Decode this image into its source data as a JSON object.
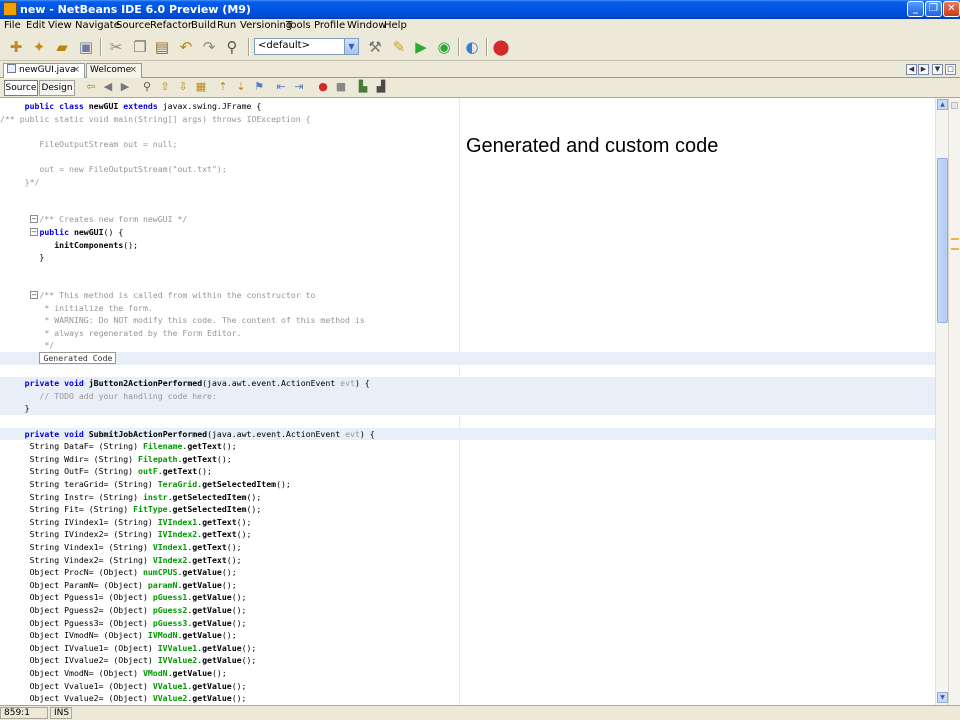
{
  "window": {
    "title": "new - NetBeans IDE 6.0 Preview (M9)"
  },
  "menu": [
    "File",
    "Edit",
    "View",
    "Navigate",
    "Source",
    "Refactor",
    "Build",
    "Run",
    "Versioning",
    "Tools",
    "Profile",
    "Window",
    "Help"
  ],
  "toolbar": {
    "config_value": "<default>"
  },
  "tabs": [
    {
      "label": "newGUI.java",
      "active": true
    },
    {
      "label": "Welcome",
      "active": false
    }
  ],
  "editor_modes": {
    "source": "Source",
    "design": "Design"
  },
  "annotation": "Generated and custom code",
  "code_lines": [
    "public class newGUI extends javax.swing.JFrame {",
    "/** public static void main(String[] args) throws IOException {",
    "",
    "    FileOutputStream out = null;",
    "",
    "    out = new FileOutputStream(\"out.txt\");",
    "}*/",
    "",
    "",
    "    /** Creates new form newGUI */",
    "    public newGUI() {",
    "        initComponents();",
    "    }",
    "",
    "",
    "    /** This method is called from within the constructor to",
    "     * initialize the form.",
    "     * WARNING: Do NOT modify this code. The content of this method is",
    "     * always regenerated by the Form Editor.",
    "     */",
    "Generated Code",
    "",
    "private void jButton2ActionPerformed(java.awt.event.ActionEvent evt) {",
    "    // TODO add your handling code here:",
    "}",
    "",
    "private void SubmitJobActionPerformed(java.awt.event.ActionEvent evt) {",
    " String DataF= (String) Filename.getText();",
    " String Wdir= (String) Filepath.getText();",
    " String OutF= (String) outF.getText();",
    " String teraGrid= (String) TeraGrid.getSelectedItem();",
    " String Instr= (String) instr.getSelectedItem();",
    " String Fit= (String) FitType.getSelectedItem();",
    " String IVindex1= (String) IVIndex1.getText();",
    " String IVindex2= (String) IVIndex2.getText();",
    " String Vindex1= (String) VIndex1.getText();",
    " String Vindex2= (String) VIndex2.getText();",
    " Object ProcN= (Object) numCPUS.getValue();",
    " Object ParamN= (Object) paramN.getValue();",
    " Object Pguess1= (Object) pGuess1.getValue();",
    " Object Pguess2= (Object) pGuess2.getValue();",
    " Object Pguess3= (Object) pGuess3.getValue();",
    " Object IVmodN= (Object) IVModN.getValue();",
    " Object IVvalue1= (Object) IVValue1.getValue();",
    " Object IVvalue2= (Object) IVValue2.getValue();",
    " Object VmodN= (Object) VModN.getValue();",
    " Object Vvalue1= (Object) VValue1.getValue();",
    " Object Vvalue2= (Object) VValue2.getValue();"
  ],
  "status": {
    "position": "859:1",
    "mode": "INS"
  }
}
